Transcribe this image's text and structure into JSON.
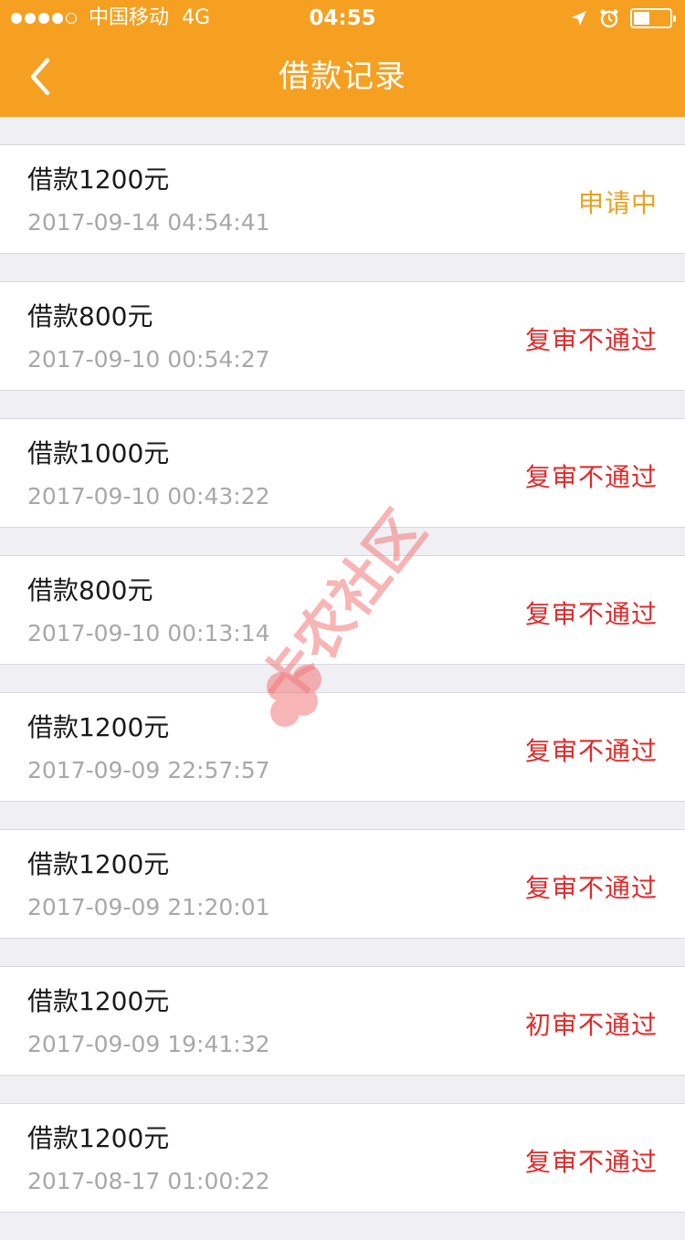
{
  "status_bar": {
    "signal_dots_filled": 4,
    "signal_dots_total": 5,
    "carrier": "中国移动",
    "network": "4G",
    "time": "04:55",
    "battery_level": 0.45
  },
  "nav": {
    "title": "借款记录",
    "back_icon": "chevron-left-icon"
  },
  "colors": {
    "header_bg": "#f5a020",
    "status_pending": "#e8a21e",
    "status_rejected": "#e02b2b",
    "time_text": "#a8a8a8",
    "page_bg": "#efeff4"
  },
  "records": [
    {
      "title": "借款1200元",
      "time": "2017-09-14 04:54:41",
      "status": "申请中",
      "status_type": "pending"
    },
    {
      "title": "借款800元",
      "time": "2017-09-10 00:54:27",
      "status": "复审不通过",
      "status_type": "rejected"
    },
    {
      "title": "借款1000元",
      "time": "2017-09-10 00:43:22",
      "status": "复审不通过",
      "status_type": "rejected"
    },
    {
      "title": "借款800元",
      "time": "2017-09-10 00:13:14",
      "status": "复审不通过",
      "status_type": "rejected"
    },
    {
      "title": "借款1200元",
      "time": "2017-09-09 22:57:57",
      "status": "复审不通过",
      "status_type": "rejected"
    },
    {
      "title": "借款1200元",
      "time": "2017-09-09 21:20:01",
      "status": "复审不通过",
      "status_type": "rejected"
    },
    {
      "title": "借款1200元",
      "time": "2017-09-09 19:41:32",
      "status": "初审不通过",
      "status_type": "rejected"
    },
    {
      "title": "借款1200元",
      "time": "2017-08-17 01:00:22",
      "status": "复审不通过",
      "status_type": "rejected"
    }
  ],
  "watermark": {
    "text": "卡农社区"
  }
}
